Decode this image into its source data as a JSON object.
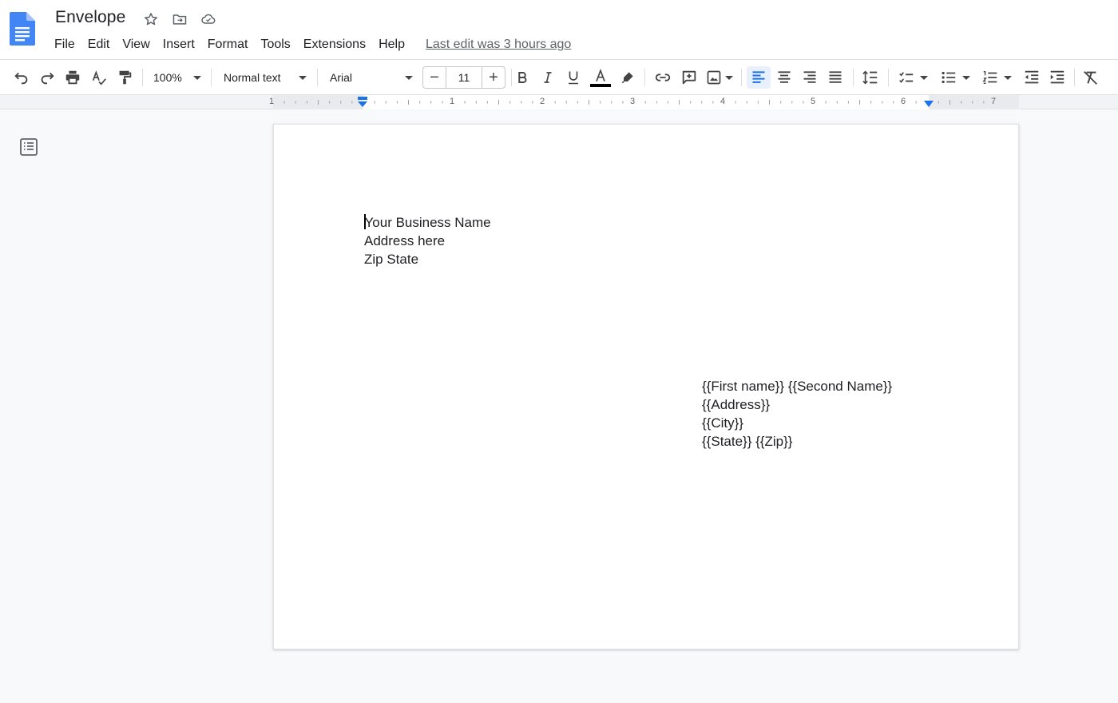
{
  "document": {
    "title": "Envelope"
  },
  "menu": {
    "items": [
      "File",
      "Edit",
      "View",
      "Insert",
      "Format",
      "Tools",
      "Extensions",
      "Help"
    ],
    "last_edit": "Last edit was 3 hours ago"
  },
  "toolbar": {
    "zoom": "100%",
    "style": "Normal text",
    "font": "Arial",
    "font_size": "11"
  },
  "ruler": {
    "labels": [
      "1",
      "1",
      "2",
      "3",
      "4",
      "5",
      "6",
      "7"
    ]
  },
  "page": {
    "return_address": [
      "Your Business Name",
      "Address here",
      "Zip State"
    ],
    "recipient": [
      "{{First name}} {{Second Name}}",
      "{{Address}}",
      "{{City}}",
      "{{State}} {{Zip}}"
    ]
  },
  "colors": {
    "accent": "#1a73e8",
    "text_color_bar": "#000000"
  }
}
